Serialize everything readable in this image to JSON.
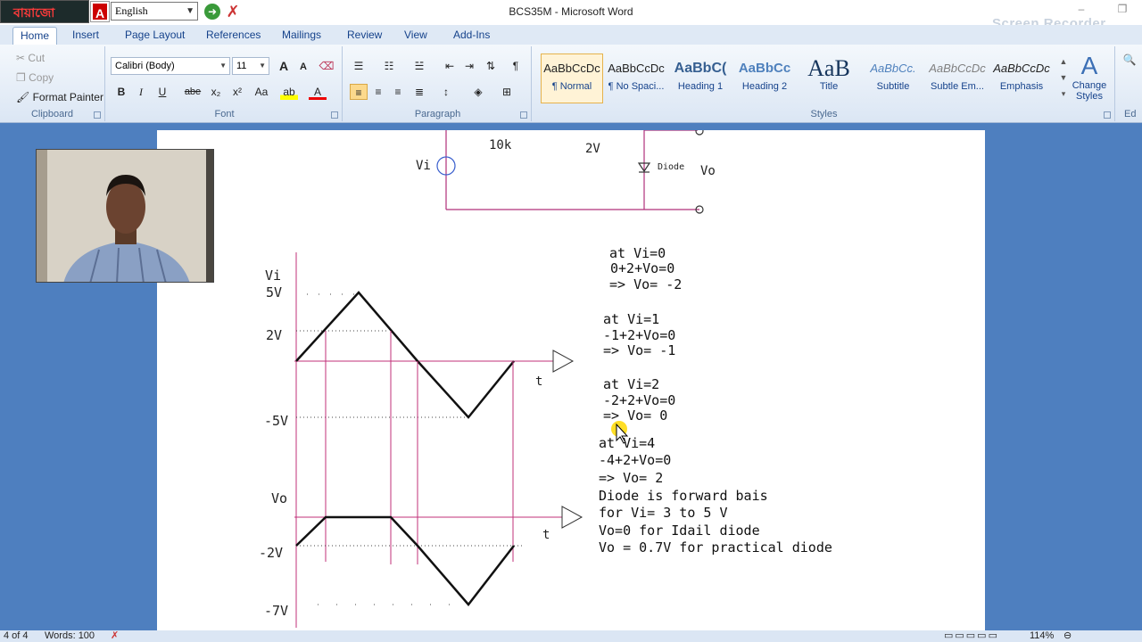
{
  "titlebar": {
    "window_title": "BCS35M - Microsoft Word",
    "language_tool_logo": "বায়াজো",
    "language_tool_icon_letter": "A",
    "language_selected": "English",
    "watermark": "Screen Recorder"
  },
  "tabs": [
    "Home",
    "Insert",
    "Page Layout",
    "References",
    "Mailings",
    "Review",
    "View",
    "Add-Ins"
  ],
  "ribbon": {
    "clipboard": {
      "cut": "Cut",
      "copy": "Copy",
      "format_painter": "Format Painter",
      "label": "Clipboard"
    },
    "font": {
      "name": "Calibri (Body)",
      "size": "11",
      "label": "Font",
      "bold": "B",
      "italic": "I",
      "underline": "U",
      "strike": "abe",
      "subscript": "x₂",
      "superscript": "x²",
      "change_case": "Aa",
      "grow": "A",
      "shrink": "A"
    },
    "paragraph": {
      "label": "Paragraph"
    },
    "styles": {
      "label": "Styles",
      "items": [
        {
          "sample": "AaBbCcDc",
          "name": "¶ Normal"
        },
        {
          "sample": "AaBbCcDc",
          "name": "¶ No Spaci..."
        },
        {
          "sample": "AaBbC(",
          "name": "Heading 1"
        },
        {
          "sample": "AaBbCc",
          "name": "Heading 2"
        },
        {
          "sample": "AaB",
          "name": "Title"
        },
        {
          "sample": "AaBbCc.",
          "name": "Subtitle"
        },
        {
          "sample": "AaBbCcDc",
          "name": "Subtle Em..."
        },
        {
          "sample": "AaBbCcDc",
          "name": "Emphasis"
        }
      ],
      "change_styles": "Change Styles",
      "editing_label": "Ed"
    }
  },
  "document": {
    "circuit": {
      "resistor": "10k",
      "battery": "2V",
      "source": "Vi",
      "diode": "Diode",
      "output": "Vo"
    },
    "graph_vi": {
      "axis_label": "Vi",
      "ticks": [
        "5V",
        "2V",
        "-5V"
      ],
      "time_label": "t"
    },
    "graph_vo": {
      "axis_label": "Vo",
      "ticks": [
        "-2V",
        "-7V"
      ],
      "time_label": "t"
    },
    "notes": [
      "at Vi=0",
      "0+2+Vo=0",
      "=> Vo= -2",
      "at Vi=1",
      "-1+2+Vo=0",
      "=> Vo= -1",
      "at Vi=2",
      "-2+2+Vo=0",
      "=> Vo= 0",
      "at Vi=4",
      "-4+2+Vo=0",
      "=> Vo= 2",
      "Diode is forward bais",
      "for Vi= 3 to 5 V",
      "Vo=0 for Idail diode",
      "Vo = 0.7V for practical diode"
    ]
  },
  "statusbar": {
    "page": "4 of 4",
    "words": "Words: 100",
    "zoom": "114%"
  }
}
